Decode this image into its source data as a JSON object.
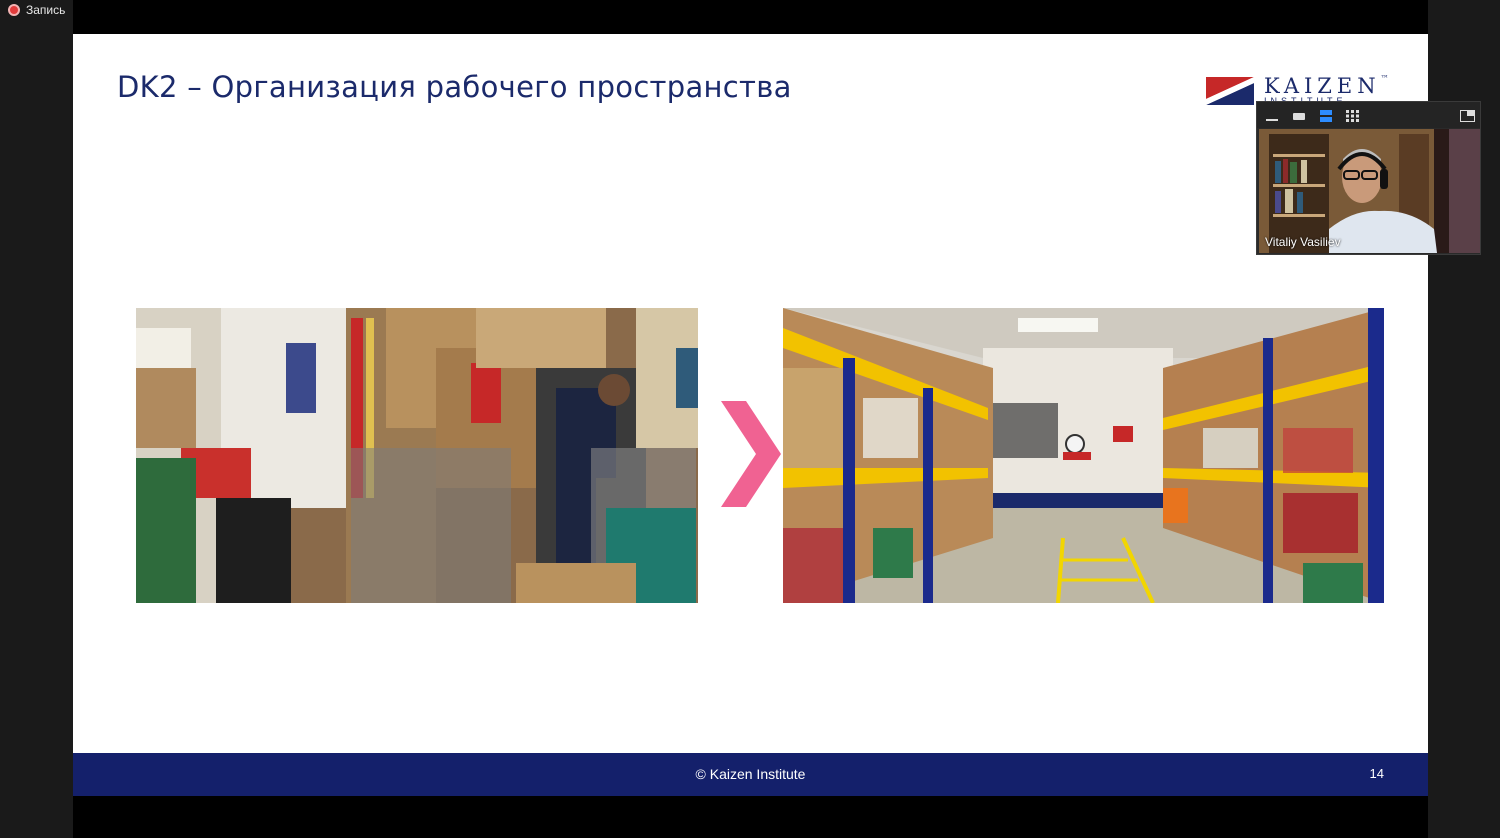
{
  "recording": {
    "label": "Запись"
  },
  "slide": {
    "title": "DK2 – Организация рабочего пространства",
    "logo": {
      "name": "KAIZEN",
      "tm": "™",
      "sub": "INSTITUTE"
    },
    "footer": {
      "copyright": "© Kaizen Institute",
      "page_number": "14"
    },
    "arrow_color": "#f06292"
  },
  "video": {
    "participant_name": "Vitaliy Vasiliev",
    "toolbar": [
      "minimize-icon",
      "stop-video-icon",
      "speaker-view-icon",
      "gallery-view-icon",
      "exit-fullscreen-icon"
    ]
  },
  "colors": {
    "title": "#1b2a6b",
    "footer_bg": "#14206b",
    "accent_red": "#c62828"
  }
}
